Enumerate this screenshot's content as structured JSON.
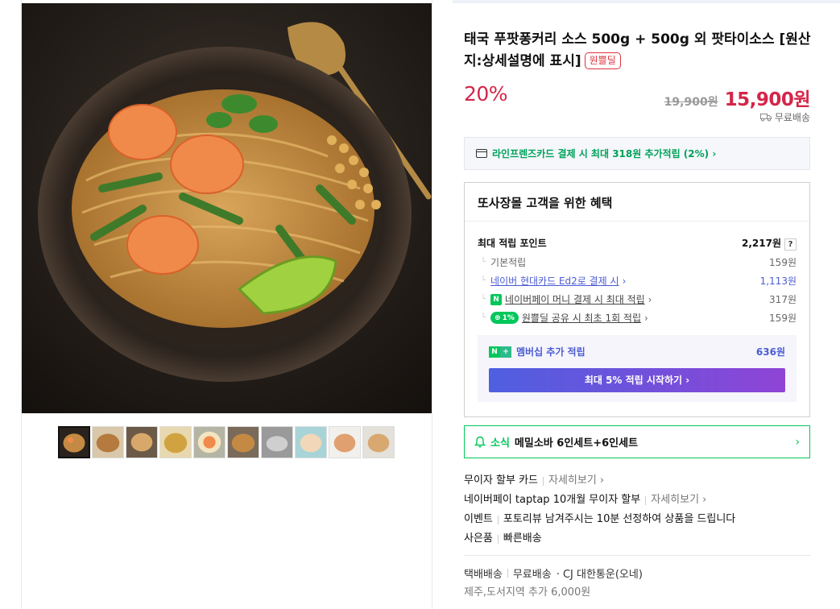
{
  "product": {
    "title": "태국 푸팟퐁커리 소스 500g + 500g 외 팟타이소스 [원산지:상세설명에 표시]",
    "badge": "원쁠딜",
    "discount": "20%",
    "original_price": "19,900원",
    "sale_price": "15,900원",
    "shipping_tag": "무료배송"
  },
  "card_banner": {
    "text": "라인프렌즈카드 결제 시 최대 318원 추가적립 (2%) ›"
  },
  "benefit": {
    "title": "또사장몰 고객을 위한 혜택",
    "max_points_label": "최대 적립 포인트",
    "max_points_value": "2,217원",
    "help": "?",
    "rows": [
      {
        "label": "기본적립",
        "value": "159원"
      },
      {
        "label": "네이버 현대카드 Ed2로 결제 시",
        "value": "1,113원"
      },
      {
        "label": "네이버페이 머니 결제 시 최대 적립",
        "value": "317원"
      },
      {
        "label": "원쁠딜 공유 시 최초 1회 적립",
        "value": "159원"
      }
    ],
    "pct_pill": "1%",
    "membership_label": "멤버십 추가 적립",
    "membership_value": "636원",
    "membership_button": "최대 5% 적립 시작하기 ›"
  },
  "news": {
    "tag": "소식",
    "text": "메밀소바 6인세트+6인세트"
  },
  "info_lines": [
    {
      "main": "무이자 할부 카드",
      "sub": "자세히보기 ›"
    },
    {
      "main": "네이버페이 taptap 10개월 무이자 할부",
      "sub": "자세히보기 ›"
    },
    {
      "main": "이벤트",
      "sub": "포토리뷰 남겨주시는 10분 선정하여 상품을 드립니다"
    },
    {
      "main": "사은품",
      "sub": "빠른배송"
    }
  ],
  "shipping": {
    "method": "택배배송",
    "fee": "무료배송",
    "carrier": "· CJ 대한통운(오네)",
    "extra": "제주,도서지역 추가 6,000원"
  },
  "colors": {
    "accent_red": "#d4264a",
    "naver_green": "#03c75a",
    "member_purple": "#4a5bd4"
  }
}
